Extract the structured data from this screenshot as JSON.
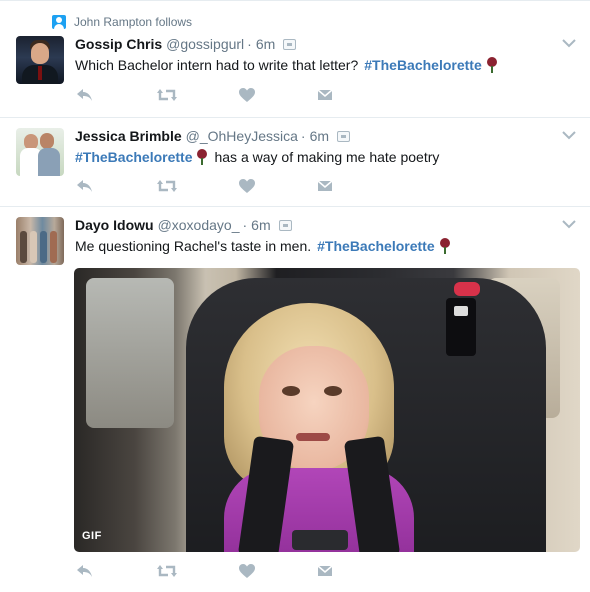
{
  "context": {
    "icon": "person-icon",
    "text": "John Rampton follows"
  },
  "tweets": [
    {
      "name": "Gossip Chris",
      "handle": "@gossipgurl",
      "separator": "·",
      "time": "6m",
      "text_before": "Which Bachelor intern had to write that letter?",
      "hashtag": "#TheBachelorette",
      "text_after": ""
    },
    {
      "name": "Jessica Brimble",
      "handle": "@_OhHeyJessica",
      "separator": "·",
      "time": "6m",
      "text_before": "",
      "hashtag": "#TheBachelorette",
      "text_after": "has a way of making me hate poetry"
    },
    {
      "name": "Dayo Idowu",
      "handle": "@xoxodayo_",
      "separator": "·",
      "time": "6m",
      "text_before": "Me questioning Rachel's taste in men.",
      "hashtag": "#TheBachelorette",
      "text_after": "",
      "media_badge": "GIF"
    }
  ],
  "colors": {
    "hashtag": "#3c7ab8",
    "muted": "#657786",
    "action_icon": "#aab8c2",
    "accent": "#1da1f2"
  },
  "icons": {
    "reply": "reply-icon",
    "retweet": "retweet-icon",
    "like": "heart-icon",
    "dm": "envelope-icon",
    "more": "chevron-down-icon",
    "emoji": "rose-icon"
  }
}
